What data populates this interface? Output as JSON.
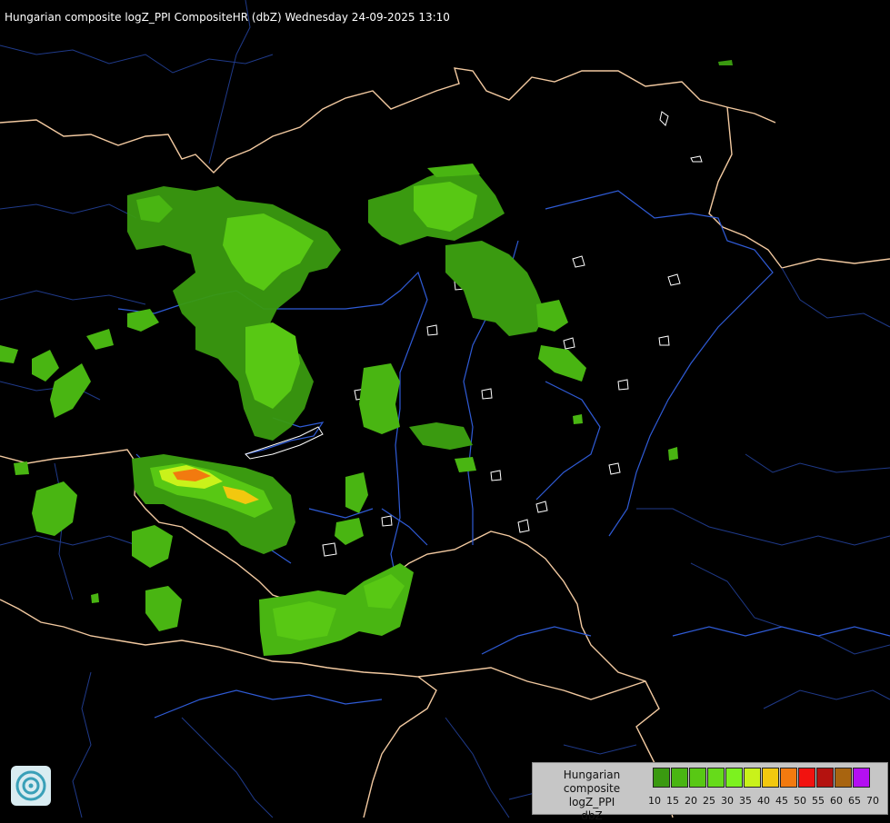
{
  "title": "Hungarian composite logZ_PPI CompositeHR (dbZ) Wednesday 24-09-2025 13:10",
  "map": {
    "background": "#000000",
    "country_border_color": "#f2c9a0",
    "admin_border_color": "#1f3a8a",
    "river_color": "#2f5bd6",
    "lake_color": "#ffffff",
    "logo_icon": "radar-logo-icon"
  },
  "legend": {
    "title_lines": [
      "Hungarian composite",
      "logZ_PPI",
      "dbZ"
    ],
    "bins": [
      {
        "label": "10",
        "color": "#3a9a10"
      },
      {
        "label": "15",
        "color": "#49b512"
      },
      {
        "label": "20",
        "color": "#58c814"
      },
      {
        "label": "25",
        "color": "#66db1a"
      },
      {
        "label": "30",
        "color": "#7cf21f"
      },
      {
        "label": "35",
        "color": "#c9f21a"
      },
      {
        "label": "40",
        "color": "#f2c80f"
      },
      {
        "label": "45",
        "color": "#f27a0f"
      },
      {
        "label": "50",
        "color": "#f2120f"
      },
      {
        "label": "55",
        "color": "#b4120f"
      },
      {
        "label": "60",
        "color": "#a8640f"
      },
      {
        "label": "65",
        "color": "#b40ff2"
      },
      {
        "label": "70",
        "color": "#b4b4f2"
      }
    ]
  }
}
